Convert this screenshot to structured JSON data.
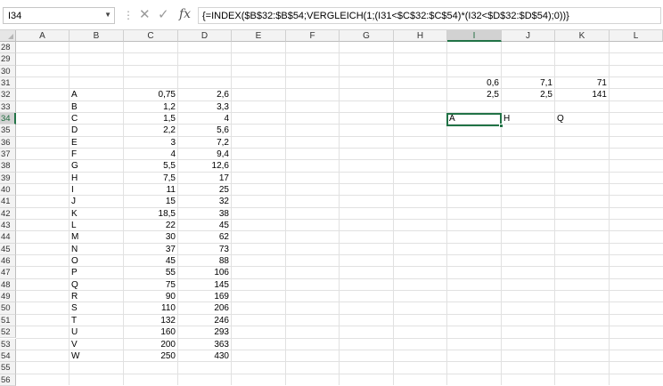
{
  "formula_bar": {
    "name_box": "I34",
    "formula": "{=INDEX($B$32:$B$54;VERGLEICH(1;(I31<$C$32:$C$54)*(I32<$D$32:$D$54);0))}",
    "fx_label": "fx"
  },
  "columns": [
    "A",
    "B",
    "C",
    "D",
    "E",
    "F",
    "G",
    "H",
    "I",
    "J",
    "K",
    "L"
  ],
  "selected_column": "I",
  "rows": [
    "28",
    "29",
    "30",
    "31",
    "32",
    "33",
    "34",
    "35",
    "36",
    "37",
    "38",
    "39",
    "40",
    "41",
    "42",
    "43",
    "44",
    "45",
    "46",
    "47",
    "48",
    "49",
    "50",
    "51",
    "52",
    "53",
    "54",
    "55",
    "56"
  ],
  "selected_row": "34",
  "table": {
    "b": [
      "A",
      "B",
      "C",
      "D",
      "E",
      "F",
      "G",
      "H",
      "I",
      "J",
      "K",
      "L",
      "M",
      "N",
      "O",
      "P",
      "Q",
      "R",
      "S",
      "T",
      "U",
      "V",
      "W"
    ],
    "c": [
      "0,75",
      "1,2",
      "1,5",
      "2,2",
      "3",
      "4",
      "5,5",
      "7,5",
      "11",
      "15",
      "18,5",
      "22",
      "30",
      "37",
      "45",
      "55",
      "75",
      "90",
      "110",
      "132",
      "160",
      "200",
      "250"
    ],
    "d": [
      "2,6",
      "3,3",
      "4",
      "5,6",
      "7,2",
      "9,4",
      "12,6",
      "17",
      "25",
      "32",
      "38",
      "45",
      "62",
      "73",
      "88",
      "106",
      "145",
      "169",
      "206",
      "246",
      "293",
      "363",
      "430"
    ]
  },
  "lookup": {
    "r31": {
      "I": "0,6",
      "J": "7,1",
      "K": "71"
    },
    "r32": {
      "I": "2,5",
      "J": "2,5",
      "K": "141"
    },
    "r34": {
      "I": "A",
      "J": "H",
      "K": "Q"
    }
  }
}
